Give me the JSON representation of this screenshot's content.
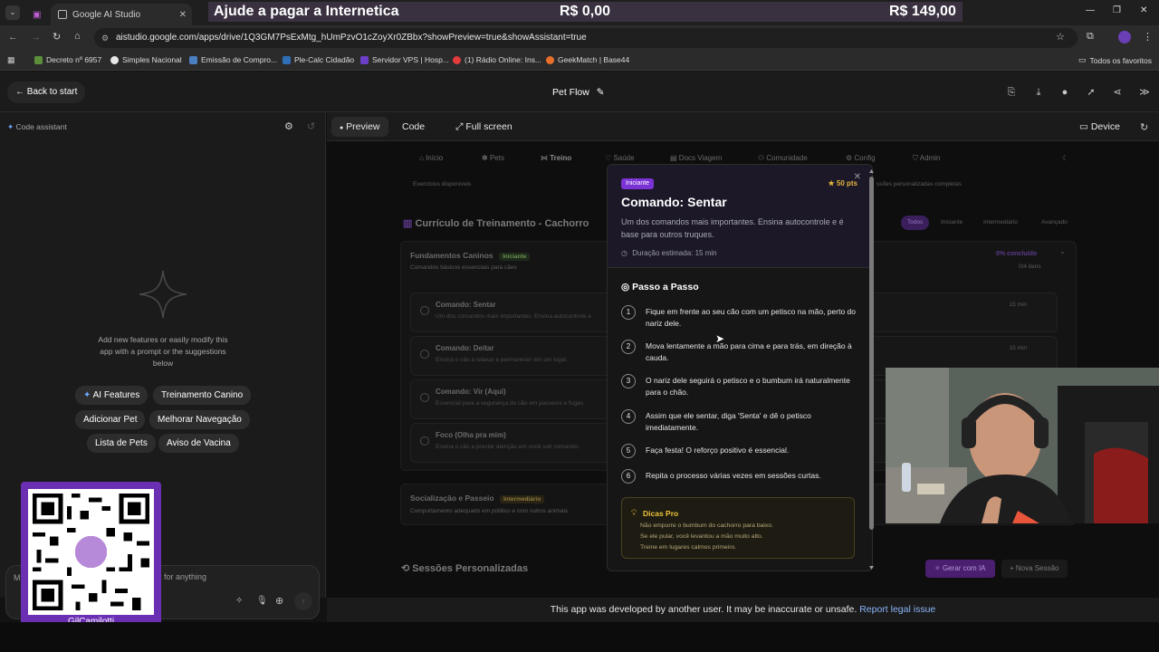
{
  "browser": {
    "tabs": [
      {
        "label": ""
      },
      {
        "label": "Google AI Studio"
      }
    ],
    "banner": {
      "text": "Ajude a pagar a Internetica",
      "amount_now": "R$ 0,00",
      "amount_goal": "R$ 149,00"
    },
    "url": "aistudio.google.com/apps/drive/1Q3GM7PsExMtg_hUmPzvO1cZoyXr0ZBbx?showPreview=true&showAssistant=true",
    "bookmarks": [
      {
        "label": "Decreto nº 6957",
        "color": "#5b8f3c"
      },
      {
        "label": "Simples Nacional",
        "color": "#e8e8e8"
      },
      {
        "label": "Emissão de Compro...",
        "color": "#4a7fc1"
      },
      {
        "label": "Ple-Calc Cidadão",
        "color": "#2f6fb6"
      },
      {
        "label": "Servidor VPS | Hosp...",
        "color": "#6c3fc7"
      },
      {
        "label": "(1) Rádio Online: Ins...",
        "color": "#e23b3b"
      },
      {
        "label": "GeekMatch | Base44",
        "color": "#e8702a"
      }
    ],
    "all_bookmarks": "Todos os favoritos"
  },
  "studio": {
    "back_label": "Back to start",
    "app_title": "Pet Flow",
    "code_assistant": "Code assistant",
    "empty_hint": "Add new features or easily modify this app with a prompt or the suggestions below",
    "chips": [
      "AI Features",
      "Treinamento Canino",
      "Adicionar Pet",
      "Melhorar Navegação",
      "Lista de Pets",
      "Aviso de Vacina"
    ],
    "prompt_placeholder_fragment": "k for anything",
    "prompt_prefix_fragment": "M",
    "qr_name": "GilCamilotti",
    "preview_tabs": [
      "Preview",
      "Code",
      "Full screen"
    ],
    "device_label": "Device",
    "footer_text": "This app was developed by another user. It may be inaccurate or unsafe.",
    "footer_link": "Report legal issue"
  },
  "app": {
    "nav": [
      "Início",
      "Pets",
      "Treino",
      "Saúde",
      "Docs Viagem",
      "Comunidade",
      "Config",
      "Admin"
    ],
    "subtitle_left": "Exercícios disponíveis",
    "subtitle_right": "ssões personalizadas completas",
    "curriculum_title": "Currículo de Treinamento - Cachorro",
    "filters": [
      "Todos",
      "Iniciante",
      "Intermediário",
      "Avançado"
    ],
    "module": {
      "title": "Fundamentos Caninos",
      "level": "Iniciante",
      "desc": "Comandos básicos essenciais para cães",
      "progress": "0% concluído",
      "items": "0/4 itens"
    },
    "lessons": [
      {
        "title": "Comando: Sentar",
        "desc": "Um dos comandos mais importantes. Ensina autocontrole e",
        "min": "15 min"
      },
      {
        "title": "Comando: Deitar",
        "desc": "Ensina o cão a relaxar e permanecer em um lugar.",
        "min": "15 min"
      },
      {
        "title": "Comando: Vir (Aqui)",
        "desc": "Essencial para a segurança do cão em passeios e fugas.",
        "min": ""
      },
      {
        "title": "Foco (Olha pra mim)",
        "desc": "Ensina o cão a prestar atenção em você sob comando.",
        "min": ""
      }
    ],
    "module2": {
      "title": "Socialização e Passeio",
      "level": "Intermediário",
      "desc": "Comportamento adequado em público e com outros animais"
    },
    "sessions_title": "Sessões Personalizadas",
    "gen_ai_btn": "Gerar com IA",
    "new_session_btn": "Nova Sessão"
  },
  "modal": {
    "level": "Iniciante",
    "points": "50 pts",
    "title": "Comando: Sentar",
    "desc": "Um dos comandos mais importantes. Ensina autocontrole e é base para outros truques.",
    "duration": "Duração estimada: 15 min",
    "steps_title": "Passo a Passo",
    "steps": [
      {
        "n": "1",
        "text": "Fique em frente ao seu cão com um petisco na mão, perto do nariz dele."
      },
      {
        "n": "2",
        "text": "Mova lentamente a mão para cima e para trás, em direção à cauda."
      },
      {
        "n": "3",
        "text": "O nariz dele seguirá o petisco e o bumbum irá naturalmente para o chão."
      },
      {
        "n": "4",
        "text": "Assim que ele sentar, diga 'Senta' e dê o petisco imediatamente."
      },
      {
        "n": "5",
        "text": "Faça festa! O reforço positivo é essencial."
      },
      {
        "n": "6",
        "text": "Repita o processo várias vezes em sessões curtas."
      }
    ],
    "tips_title": "Dicas Pro",
    "tips": [
      "Não empurre o bumbum do cachorro para baixo.",
      "Se ele pular, você levantou a mão muito alto.",
      "Treine em lugares calmos primeiro."
    ]
  }
}
